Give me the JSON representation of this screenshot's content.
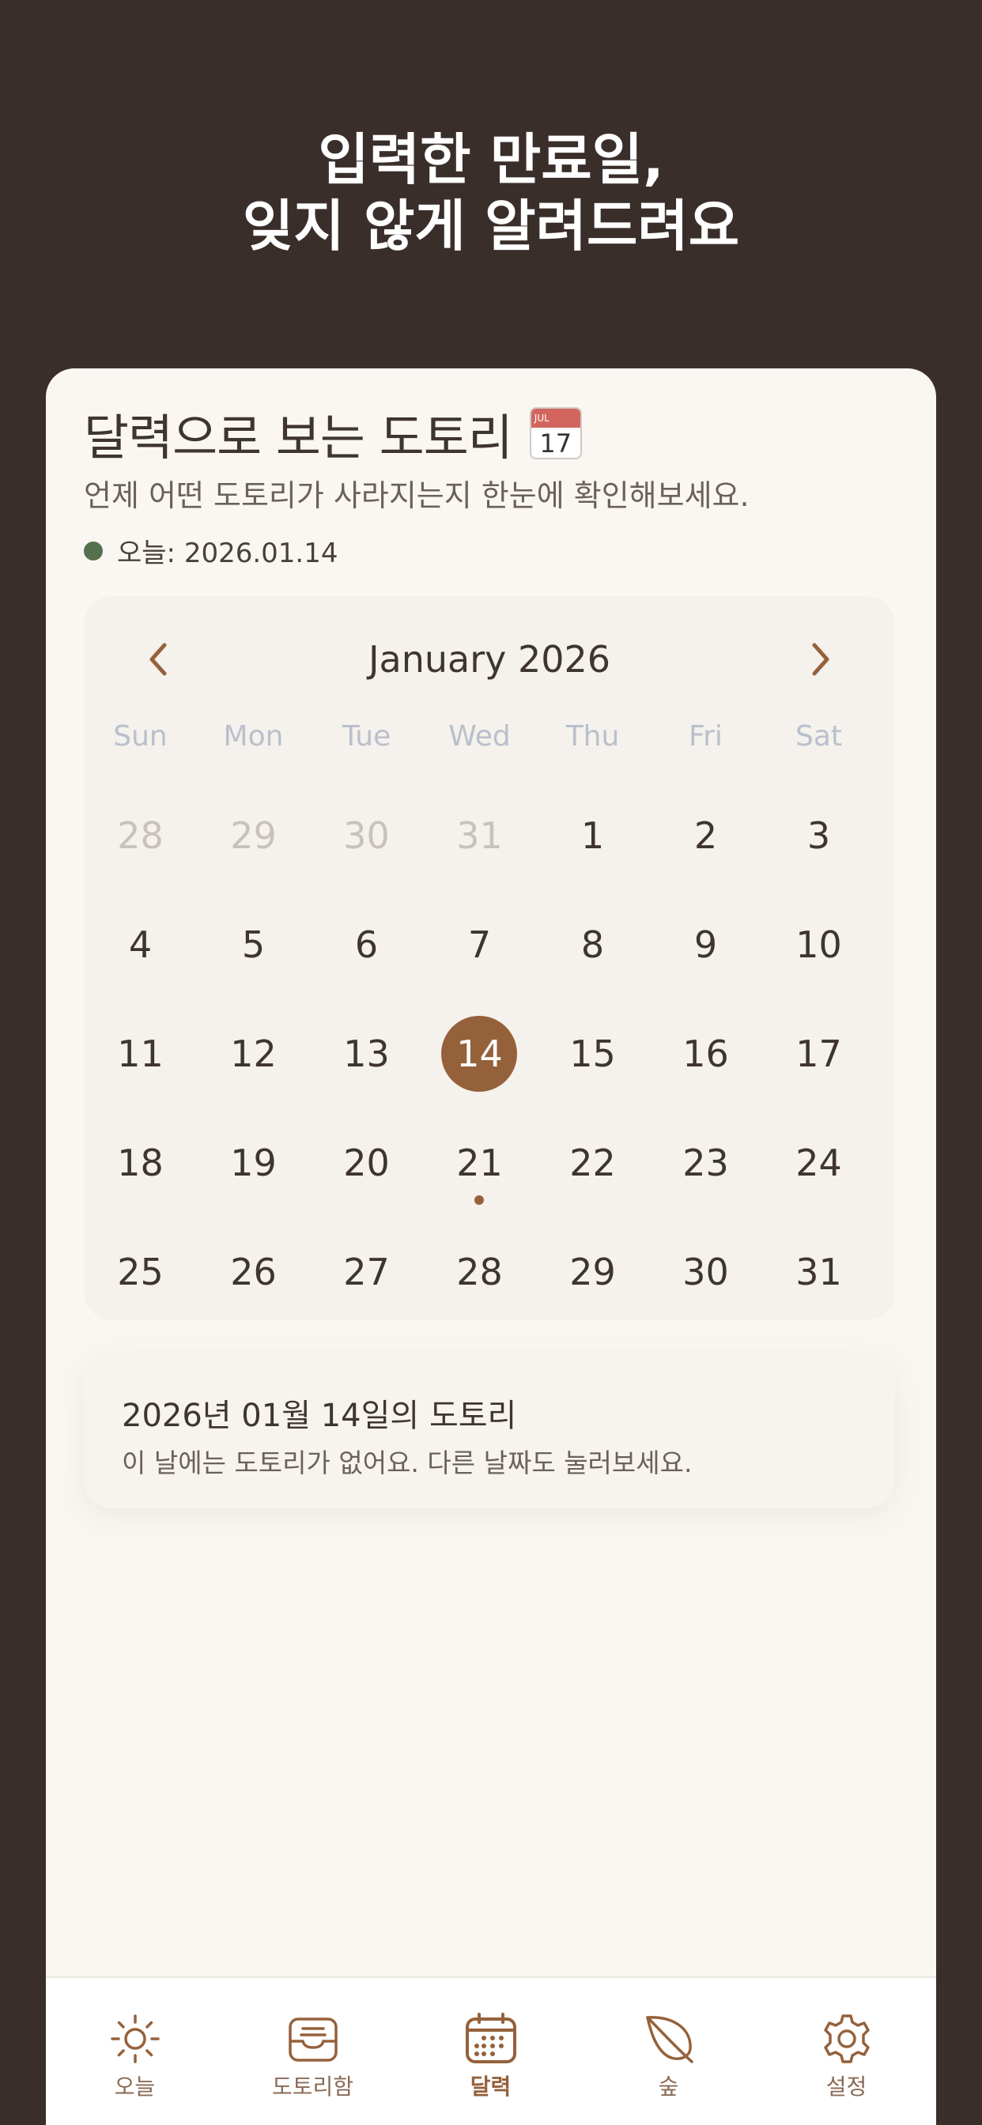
{
  "hero": {
    "line1": "입력한 만료일,",
    "line2": "잊지 않게 알려드려요"
  },
  "page": {
    "title": "달력으로 보는 도토리",
    "title_icon": "calendar-emoji-icon",
    "subtitle": "언제 어떤 도토리가 사라지는지 한눈에 확인해보세요.",
    "today_label": "오늘: 2026.01.14"
  },
  "calendar": {
    "month_label": "January 2026",
    "weekdays": [
      "Sun",
      "Mon",
      "Tue",
      "Wed",
      "Thu",
      "Fri",
      "Sat"
    ],
    "days": [
      "28",
      "29",
      "30",
      "31",
      "1",
      "2",
      "3",
      "4",
      "5",
      "6",
      "7",
      "8",
      "9",
      "10",
      "11",
      "12",
      "13",
      "14",
      "15",
      "16",
      "17",
      "18",
      "19",
      "20",
      "21",
      "22",
      "23",
      "24",
      "25",
      "26",
      "27",
      "28",
      "29",
      "30",
      "31"
    ],
    "muted_days": [
      0,
      1,
      2,
      3
    ],
    "selected_index": 17,
    "marked_indices": [
      24
    ],
    "accent_color": "#95613b"
  },
  "detail": {
    "title": "2026년 01월 14일의 도토리",
    "message": "이 날에는 도토리가 없어요. 다른 날짜도 눌러보세요."
  },
  "tabbar": {
    "tabs": [
      {
        "label": "오늘",
        "icon": "sun-icon"
      },
      {
        "label": "도토리함",
        "icon": "inbox-icon"
      },
      {
        "label": "달력",
        "icon": "calendar-icon"
      },
      {
        "label": "숲",
        "icon": "leaf-icon"
      },
      {
        "label": "설정",
        "icon": "gear-icon"
      }
    ],
    "active_index": 2
  }
}
